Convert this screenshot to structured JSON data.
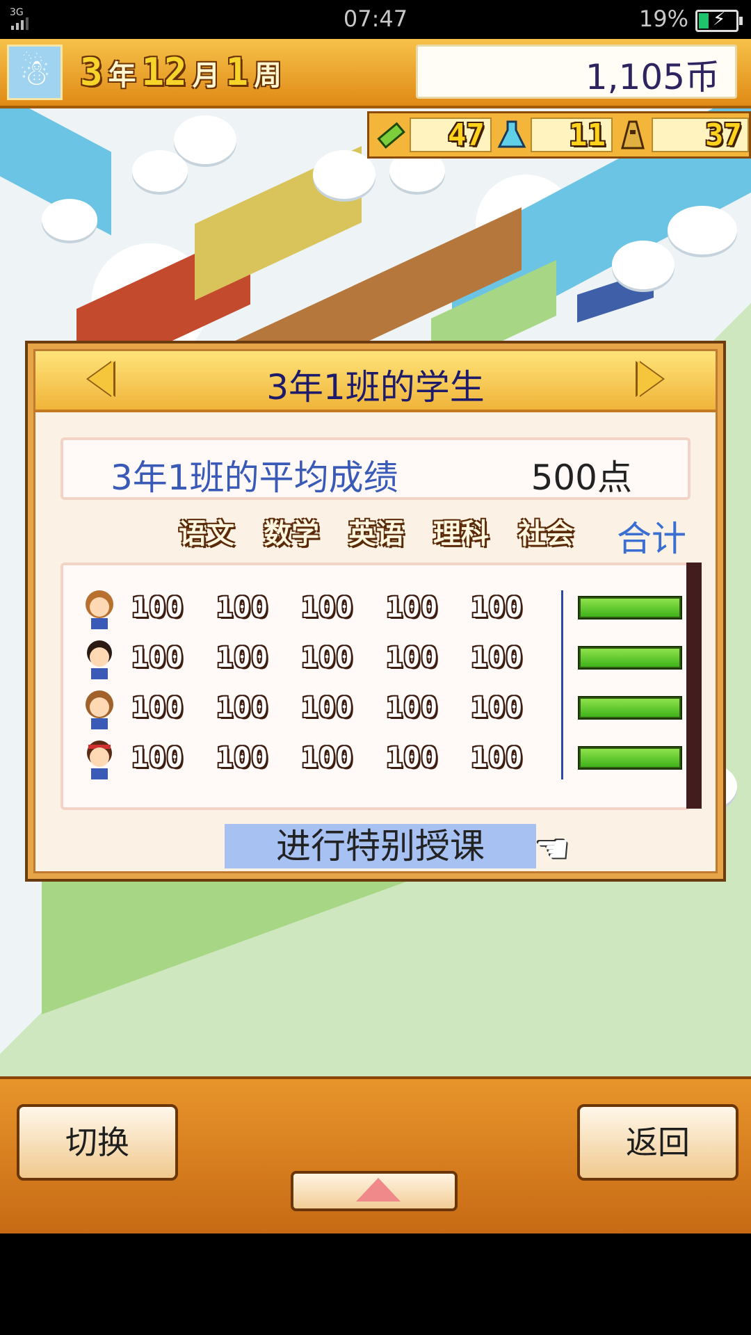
{
  "status_bar": {
    "network": "3G",
    "time": "07:47",
    "battery_percent": "19%",
    "battery_level": 0.19
  },
  "header": {
    "year": "3",
    "year_unit": "年",
    "month": "12",
    "month_unit": "月",
    "week": "1",
    "week_unit": "周",
    "money": "1,105币"
  },
  "stats": [
    {
      "icon": "tag-icon",
      "value": "47"
    },
    {
      "icon": "flask-icon",
      "value": "11"
    },
    {
      "icon": "tower-icon",
      "value": "37"
    }
  ],
  "dialog": {
    "title": "3年1班的学生",
    "average_label": "3年1班的平均成绩",
    "average_value": "500点",
    "columns": [
      "语文",
      "数学",
      "英语",
      "理科",
      "社会"
    ],
    "total_label": "合计",
    "students": [
      {
        "scores": [
          "100",
          "100",
          "100",
          "100",
          "100"
        ],
        "total_level": 1.0
      },
      {
        "scores": [
          "100",
          "100",
          "100",
          "100",
          "100"
        ],
        "total_level": 1.0
      },
      {
        "scores": [
          "100",
          "100",
          "100",
          "100",
          "100"
        ],
        "total_level": 1.0
      },
      {
        "scores": [
          "100",
          "100",
          "100",
          "100",
          "100"
        ],
        "total_level": 1.0
      }
    ],
    "special_button": "进行特别授课"
  },
  "bottom_bar": {
    "switch_label": "切换",
    "back_label": "返回"
  },
  "colors": {
    "header_orange": "#f6c24a",
    "title_text": "#1d1b6a",
    "blue_text": "#3a5ab8",
    "bar_green": "#3fb21a",
    "highlight_blue": "#a6c1f2"
  }
}
